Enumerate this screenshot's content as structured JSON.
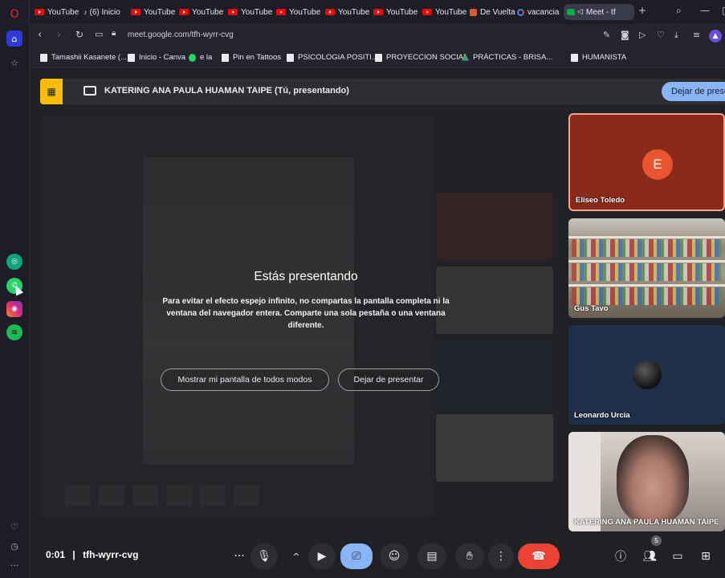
{
  "tabs": [
    {
      "label": "YouTube",
      "icon": "youtube-icon"
    },
    {
      "label": "(6) Inicio",
      "icon": "tiktok-icon"
    },
    {
      "label": "YouTube",
      "icon": "youtube-icon"
    },
    {
      "label": "YouTube",
      "icon": "youtube-icon"
    },
    {
      "label": "YouTube",
      "icon": "youtube-icon"
    },
    {
      "label": "YouTube",
      "icon": "youtube-icon"
    },
    {
      "label": "YouTube",
      "icon": "youtube-icon"
    },
    {
      "label": "YouTube",
      "icon": "youtube-icon"
    },
    {
      "label": "YouTube",
      "icon": "youtube-icon"
    },
    {
      "label": "De Vuelta",
      "icon": "site-icon"
    },
    {
      "label": "vacancia",
      "icon": "google-icon"
    },
    {
      "label": "Meet - tf",
      "icon": "meet-icon",
      "active": true
    }
  ],
  "address": {
    "url": "meet.google.com/tfh-wyrr-cvg"
  },
  "bookmarks": [
    {
      "label": "Tamashii Kasanete (...",
      "icon": "page-icon"
    },
    {
      "label": "Inicio - Canva",
      "icon": "canva-icon"
    },
    {
      "label": "e la",
      "icon": "whatsapp-icon"
    },
    {
      "label": "Pin en Tattoos",
      "icon": "page-icon"
    },
    {
      "label": "PSICOLOGIA POSITI...",
      "icon": "page-icon"
    },
    {
      "label": "PROYECCION SOCIAL",
      "icon": "page-icon"
    },
    {
      "label": "PRÁCTICAS - BRISA...",
      "icon": "drive-icon"
    },
    {
      "label": "HUMANISTA",
      "icon": "page-icon"
    }
  ],
  "banner": {
    "presenter_text": "KATERING ANA PAULA HUAMAN TAIPE (Tú, presentando)",
    "stop_button": "Dejar de presentar"
  },
  "dialog": {
    "title": "Estás presentando",
    "body": "Para evitar el efecto espejo infinito, no compartas la pantalla completa ni la ventana del navegador entera. Comparte una sola pestaña o una ventana diferente.",
    "show_anyway": "Mostrar mi pantalla de todos modos",
    "stop_presenting": "Dejar de presentar"
  },
  "participants": [
    {
      "name": "Eliseo Toledo",
      "initial": "E",
      "avatar_color": "#e8552f"
    },
    {
      "name": "Gus Tavo"
    },
    {
      "name": "Leonardo Urcia"
    },
    {
      "name": "KATERING ANA PAULA HUAMAN TAIPE"
    }
  ],
  "meeting": {
    "time": "0:01",
    "separator": "|",
    "code": "tfh-wyrr-cvg",
    "people_count": "5"
  },
  "colors": {
    "accent": "#8ab4f8",
    "hangup": "#ea4335",
    "present_warning": "#fbbc04"
  }
}
